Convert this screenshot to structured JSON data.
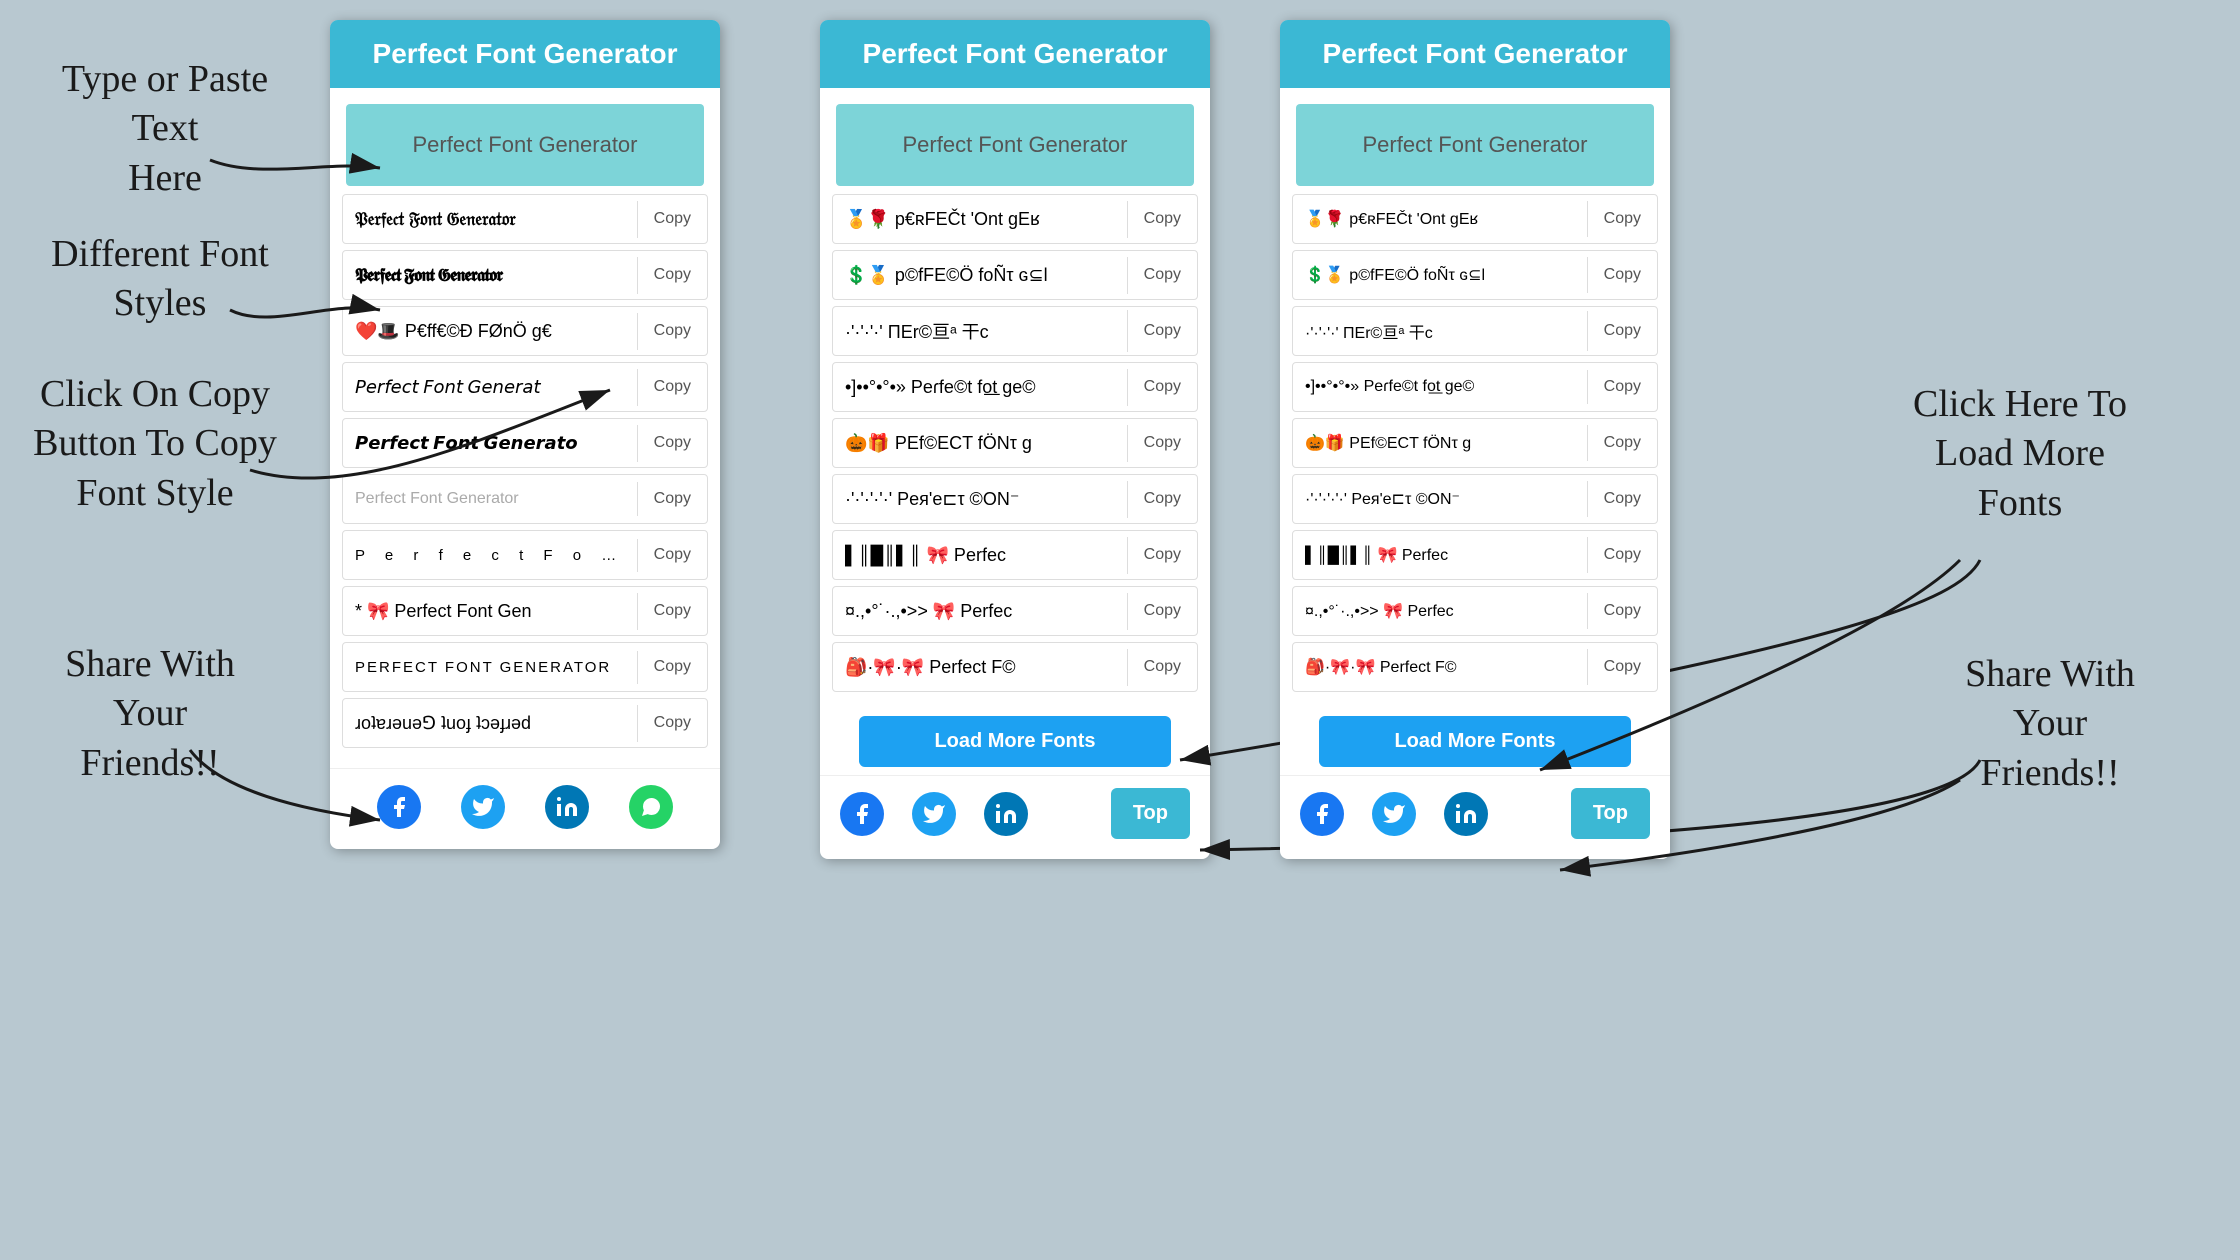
{
  "app": {
    "title": "Perfect Font Generator",
    "input_placeholder": "Perfect Font Generator"
  },
  "annotations": {
    "type_paste": "Type or Paste Text\nHere",
    "different_fonts": "Different Font\nStyles",
    "click_copy": "Click On Copy\nButton To Copy\nFont Style",
    "share_friends_left": "Share With\nYour\nFriends!!",
    "click_load": "Click Here To\nLoad More\nFonts",
    "share_friends_right": "Share With\nYour\nFriends!!"
  },
  "left_panel": {
    "header": "Perfect Font Generator",
    "input_value": "Perfect Font Generator",
    "font_rows": [
      {
        "text": "𝔓𝔢𝔯𝔣𝔢𝔠𝔱 𝔉𝔬𝔫𝔱 𝔊𝔢𝔫𝔢𝔯𝔞𝔱𝔬𝔯",
        "style": "fraktur",
        "copy": "Copy"
      },
      {
        "text": "𝕻𝖊𝖗𝖋𝖊𝖈𝖙 𝕱𝖔𝖓𝖙 𝕲𝖊𝖓𝖊𝖗𝖆𝖙𝖔𝖗",
        "style": "bold-fraktur",
        "copy": "Copy"
      },
      {
        "text": "❤️🎩 P€ff€©Ð FØnÖ g€",
        "style": "emoji",
        "copy": "Copy"
      },
      {
        "text": "𝘗𝘦𝘳𝘧𝘦𝘤𝘵 𝘍𝘰𝘯𝘵 𝘎𝘦𝘯𝘦𝘳𝘢𝘵",
        "style": "italic",
        "copy": "Copy"
      },
      {
        "text": "𝙋𝙚𝙧𝙛𝙚𝙘𝙩 𝙁𝙤𝙣𝙩 𝙂𝙚𝙣𝙚𝙧𝙖𝙩𝙤",
        "style": "italic2",
        "copy": "Copy"
      },
      {
        "text": "Perfect Font Generator",
        "style": "light",
        "copy": "Copy"
      },
      {
        "text": "P e r f e c t  F o n t",
        "style": "spaced",
        "copy": "Copy"
      },
      {
        "text": "* 🎀 Perfect Font Gen",
        "style": "normal",
        "copy": "Copy"
      },
      {
        "text": "PERFECT FONT GENERATOR",
        "style": "upper",
        "copy": "Copy"
      },
      {
        "text": "ɹoʇɐɹǝuǝ⅁ ʇuoɟ ʇɔǝɟɹǝd",
        "style": "flip",
        "copy": "Copy"
      }
    ],
    "social": [
      "facebook",
      "twitter",
      "linkedin",
      "whatsapp"
    ]
  },
  "right_panel": {
    "header": "Perfect Font Generator",
    "input_value": "Perfect Font Generator",
    "font_rows": [
      {
        "text": "p€ʀFEČt 'Ont gEʁ",
        "prefix": "🏅🌹",
        "copy": "Copy"
      },
      {
        "text": "p©fFE©Ö foÑτ ɢ⊆l",
        "prefix": "💲🏅",
        "copy": "Copy"
      },
      {
        "text": "ΠEr©亘ᵃ 干c",
        "prefix": "·'·'·'·'",
        "copy": "Copy"
      },
      {
        "text": "PeɾfeOt fo͟t ge©",
        "prefix": "•]••°•°•»",
        "copy": "Copy"
      },
      {
        "text": "PEf©ECT fÖNτ g",
        "prefix": "🎃🎁",
        "copy": "Copy"
      },
      {
        "text": "Peя'e⊏τ ©ON⁻",
        "prefix": "·'·'·'·'·'",
        "copy": "Copy"
      },
      {
        "text": "Perfec",
        "prefix": "▌║█║▌║ 🎀",
        "copy": "Copy"
      },
      {
        "text": "Perfec",
        "prefix": "¤.,•°˙·.,•>> 🎀",
        "copy": "Copy"
      },
      {
        "text": "Perfect F©",
        "prefix": "🎒·🎀·🎀",
        "copy": "Copy"
      }
    ],
    "load_more": "Load More Fonts",
    "top_btn": "Top",
    "social": [
      "facebook",
      "twitter",
      "linkedin"
    ]
  },
  "buttons": {
    "copy_label": "Copy",
    "load_more_label": "Load More Fonts",
    "top_label": "Top"
  },
  "colors": {
    "header_bg": "#3bb8d4",
    "input_bg": "#7dd4d8",
    "load_more_bg": "#1da1f2",
    "top_bg": "#3bb8d4",
    "body_bg": "#b8c8d0"
  }
}
